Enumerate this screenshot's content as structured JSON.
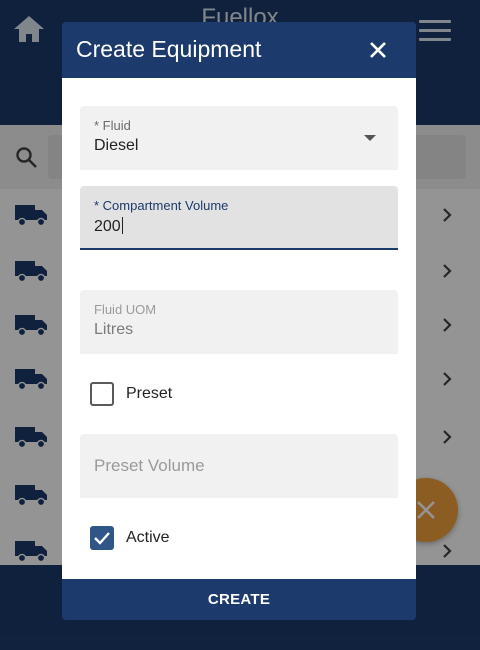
{
  "app": {
    "title": "Fuellox",
    "icons": {
      "home": "home-icon",
      "menu": "menu-icon",
      "search": "search-icon",
      "list_item": "truck-icon",
      "list_chevron": "chevron-right-icon",
      "fab": "close-icon"
    },
    "list_item_count": 7
  },
  "dialog": {
    "title": "Create Equipment",
    "close_icon": "close-icon",
    "fields": {
      "fluid": {
        "label": "* Fluid",
        "value": "Diesel",
        "icon": "dropdown-arrow-icon"
      },
      "compartment_volume": {
        "label": "* Compartment Volume",
        "value": "200"
      },
      "fluid_uom": {
        "label": "Fluid UOM",
        "value": "Litres"
      },
      "preset": {
        "label": "Preset",
        "checked": false
      },
      "preset_volume": {
        "placeholder": "Preset Volume",
        "value": ""
      },
      "active": {
        "label": "Active",
        "checked": true
      }
    },
    "create_label": "CREATE"
  },
  "colors": {
    "primary": "#1c3a6b",
    "accent": "#f0a13c",
    "checkbox_checked": "#2f5686",
    "field_bg": "#f1f1f1"
  }
}
